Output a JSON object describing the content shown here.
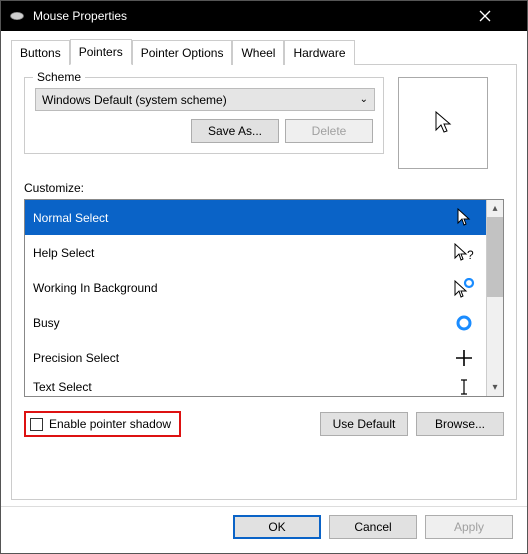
{
  "window": {
    "title": "Mouse Properties"
  },
  "tabs": {
    "buttons": "Buttons",
    "pointers": "Pointers",
    "pointer_options": "Pointer Options",
    "wheel": "Wheel",
    "hardware": "Hardware"
  },
  "scheme": {
    "legend": "Scheme",
    "selected": "Windows Default (system scheme)",
    "save_as": "Save As...",
    "delete": "Delete"
  },
  "customize_label": "Customize:",
  "cursors": {
    "normal": "Normal Select",
    "help": "Help Select",
    "working": "Working In Background",
    "busy": "Busy",
    "precision": "Precision Select",
    "text": "Text Select"
  },
  "shadow_label": "Enable pointer shadow",
  "use_default": "Use Default",
  "browse": "Browse...",
  "footer": {
    "ok": "OK",
    "cancel": "Cancel",
    "apply": "Apply"
  }
}
